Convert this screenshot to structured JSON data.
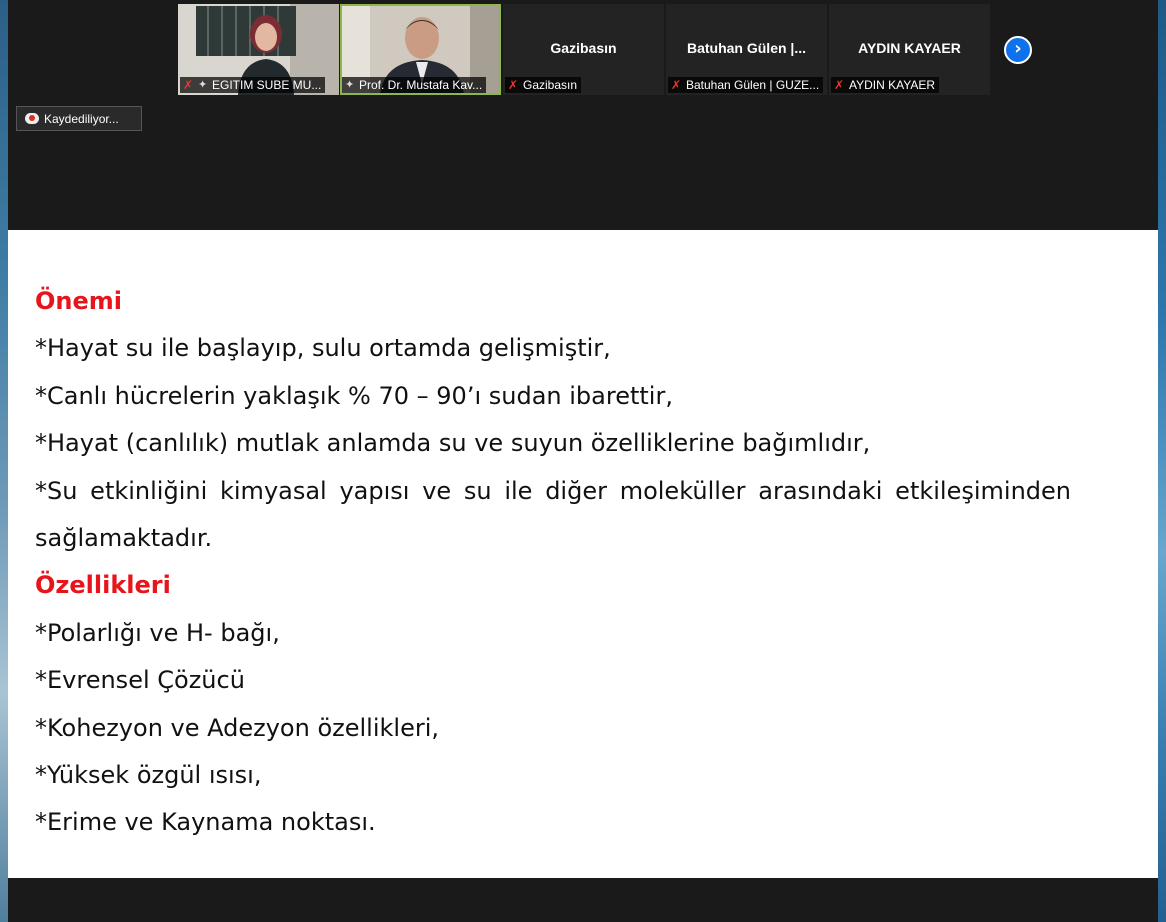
{
  "participants": [
    {
      "label": "EGITIM SUBE MU...",
      "type": "video",
      "muted": true,
      "pinned": true
    },
    {
      "label": "Prof. Dr. Mustafa Kav...",
      "type": "video",
      "muted": false,
      "pinned": true,
      "active_speaker": true
    },
    {
      "name": "Gazibasın",
      "label": "Gazibasın",
      "type": "name",
      "muted": true
    },
    {
      "name": "Batuhan Gülen |...",
      "label": "Batuhan Gülen | GUZE...",
      "type": "name",
      "muted": true
    },
    {
      "name": "AYDIN KAYAER",
      "label": "AYDIN KAYAER",
      "type": "name",
      "muted": true
    }
  ],
  "recording_label": "Kaydediliyor...",
  "colors": {
    "heading": "#e8141b",
    "active_outline": "#8fb64a",
    "next_button": "#0e72ed",
    "mic_off": "#e8382c"
  },
  "slide": {
    "heading_1": "Önemi",
    "lines_1": [
      "*Hayat su ile başlayıp, sulu ortamda gelişmiştir,",
      "*Canlı hücrelerin yaklaşık % 70 – 90’ı sudan ibarettir,",
      "*Hayat (canlılık) mutlak anlamda su ve suyun özelliklerine bağımlıdır,",
      "*Su etkinliğini kimyasal yapısı ve su ile diğer moleküller arasındaki etkileşiminden",
      "sağlamaktadır."
    ],
    "heading_2": "Özellikleri",
    "lines_2": [
      "*Polarlığı ve H- bağı,",
      "*Evrensel Çözücü",
      "*Kohezyon ve Adezyon özellikleri,",
      "*Yüksek özgül ısısı,",
      "*Erime ve Kaynama noktası."
    ]
  }
}
